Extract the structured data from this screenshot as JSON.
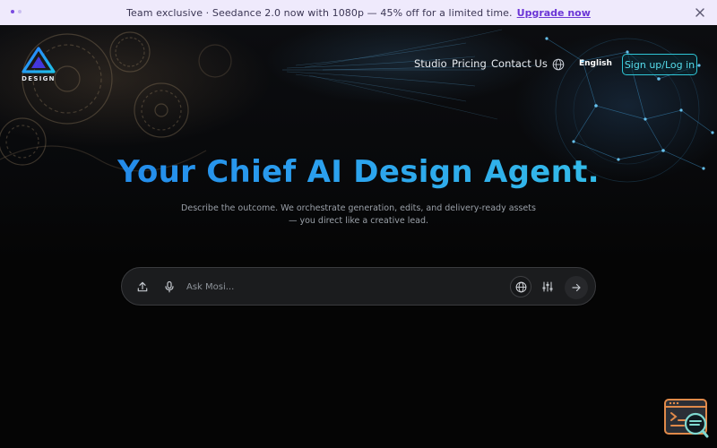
{
  "announcement": {
    "message": "Team exclusive · Seedance 2.0 now with 1080p — 45% off for a limited time.",
    "cta": "Upgrade now",
    "close_icon": "close-icon"
  },
  "logo": {
    "text": "DESIGN"
  },
  "nav": {
    "links": [
      "Studio",
      "Pricing",
      "Contact Us"
    ],
    "language": "English",
    "signup": "Sign up/Log in"
  },
  "hero": {
    "headline": "Your Chief AI Design Agent.",
    "subline": "Describe the outcome. We orchestrate generation, edits, and delivery-ready assets — you direct like a creative lead."
  },
  "prompt": {
    "placeholder": "Ask Mosi...",
    "icons": [
      "upload-icon",
      "microphone-icon",
      "globe-icon",
      "sliders-icon",
      "arrow-right-icon"
    ]
  },
  "colors": {
    "banner_bg": "#efeafc",
    "accent_purple": "#6b35d6",
    "accent_cyan": "#2fc6d6",
    "headline_start": "#1f7fe8",
    "headline_end": "#37c7e6",
    "helper_orange": "#e08a4a"
  }
}
